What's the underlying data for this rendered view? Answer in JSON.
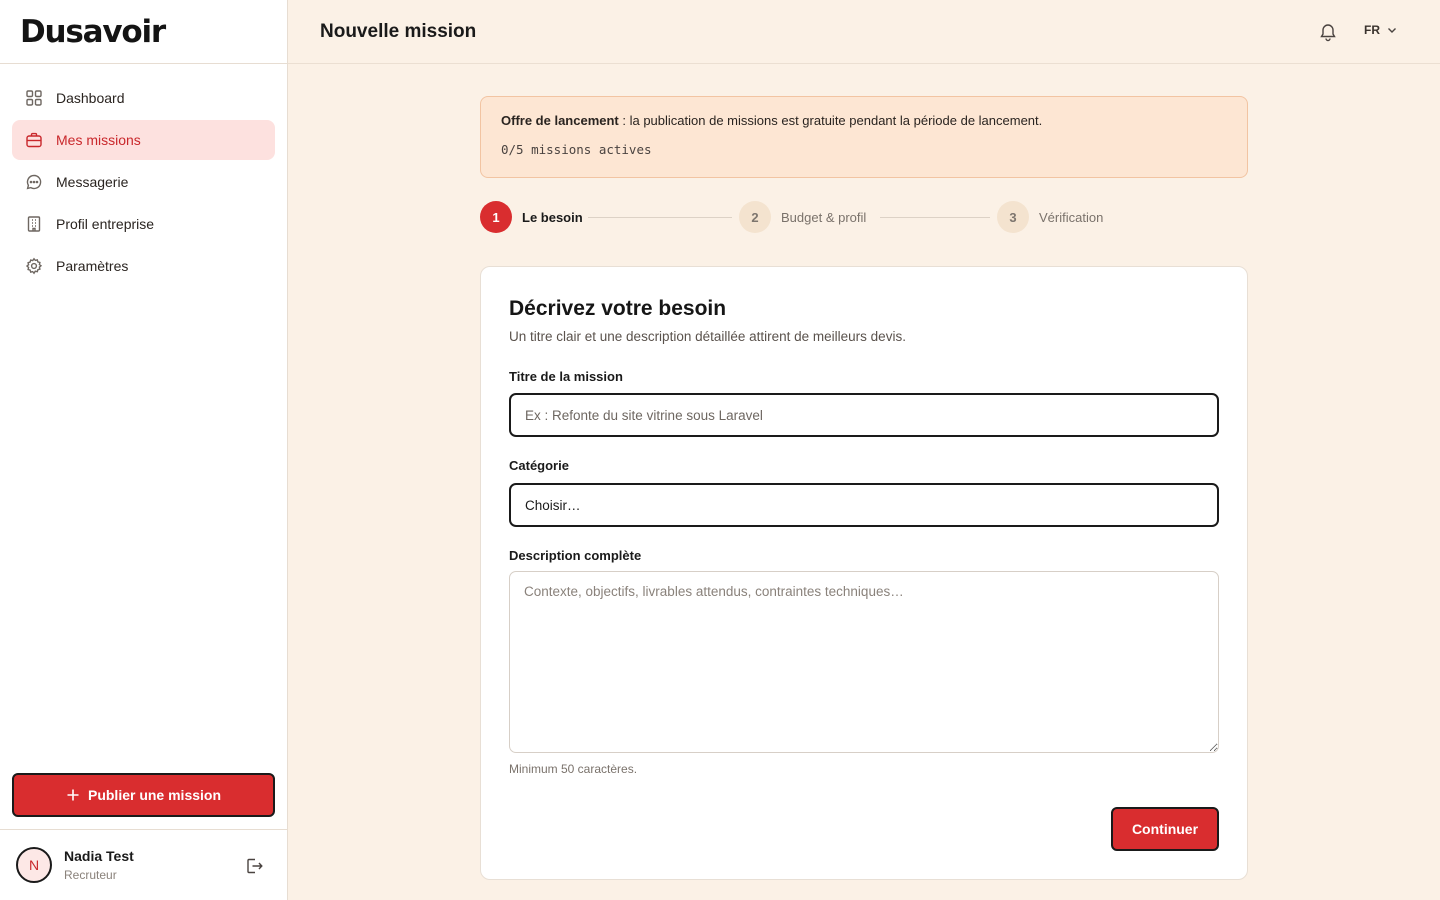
{
  "brand": {
    "name": "Dusavoir",
    "accent": "#d92d2f"
  },
  "sidebar": {
    "items": [
      {
        "label": "Dashboard",
        "icon": "grid-icon",
        "active": false
      },
      {
        "label": "Mes missions",
        "icon": "briefcase-icon",
        "active": true
      },
      {
        "label": "Messagerie",
        "icon": "chat-bubble-icon",
        "active": false
      },
      {
        "label": "Profil entreprise",
        "icon": "building-icon",
        "active": false
      },
      {
        "label": "Paramètres",
        "icon": "gear-icon",
        "active": false
      }
    ],
    "publish_button": "Publier une mission",
    "user": {
      "initial": "N",
      "name": "Nadia Test",
      "role": "Recruteur"
    }
  },
  "header": {
    "title": "Nouvelle mission",
    "language": "FR"
  },
  "promo": {
    "bold": "Offre de lancement",
    "text": " : la publication de missions est gratuite pendant la période de lancement.",
    "count": "0/5 missions actives"
  },
  "steps": [
    {
      "number": "1",
      "label": "Le besoin",
      "active": true
    },
    {
      "number": "2",
      "label": "Budget & profil",
      "active": false
    },
    {
      "number": "3",
      "label": "Vérification",
      "active": false
    }
  ],
  "form": {
    "title": "Décrivez votre besoin",
    "subtitle": "Un titre clair et une description détaillée attirent de meilleurs devis.",
    "mission_title_label": "Titre de la mission",
    "mission_title_placeholder": "Ex : Refonte du site vitrine sous Laravel",
    "category_label": "Catégorie",
    "category_value": "Choisir…",
    "description_label": "Description complète",
    "description_placeholder": "Contexte, objectifs, livrables attendus, contraintes techniques…",
    "description_helper": "Minimum 50 caractères.",
    "continue_button": "Continuer"
  }
}
